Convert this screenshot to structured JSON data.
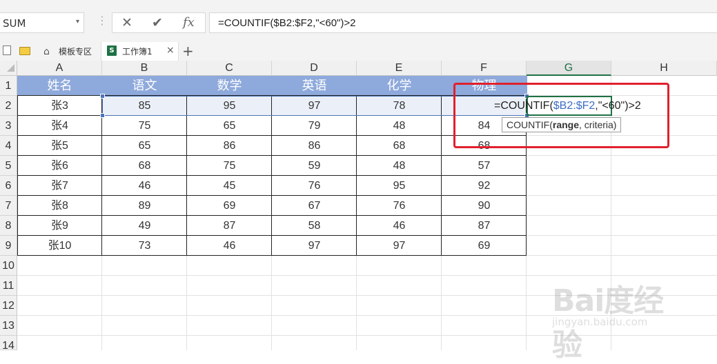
{
  "formula_bar": {
    "name_box": "SUM",
    "name_box_arrow": "▾",
    "cancel_glyph": "✕",
    "enter_glyph": "✔",
    "fx_glyph": "fx",
    "formula": "=COUNTIF($B2:$F2,\"<60\")>2"
  },
  "tabs": {
    "templates_label": "模板专区",
    "workbook_label": "工作簿1",
    "workbook_icon_text": "S",
    "close_glyph": "×",
    "add_glyph": "+"
  },
  "icons": {
    "new_file": "file-icon",
    "open_folder": "folder-icon",
    "home": "home-icon",
    "spreadsheet": "spreadsheet-icon"
  },
  "columns": [
    "A",
    "B",
    "C",
    "D",
    "E",
    "F",
    "G",
    "H"
  ],
  "rows": [
    "1",
    "2",
    "3",
    "4",
    "5",
    "6",
    "7",
    "8",
    "9",
    "10",
    "11",
    "12",
    "13",
    "14"
  ],
  "table": {
    "headers": [
      "姓名",
      "语文",
      "数学",
      "英语",
      "化学",
      "物理"
    ],
    "data": [
      [
        "张3",
        "85",
        "95",
        "97",
        "78",
        ""
      ],
      [
        "张4",
        "75",
        "65",
        "79",
        "48",
        "84"
      ],
      [
        "张5",
        "65",
        "86",
        "86",
        "68",
        "68"
      ],
      [
        "张6",
        "68",
        "75",
        "59",
        "48",
        "57"
      ],
      [
        "张7",
        "46",
        "45",
        "76",
        "95",
        "92"
      ],
      [
        "张8",
        "89",
        "69",
        "67",
        "76",
        "90"
      ],
      [
        "张9",
        "49",
        "87",
        "58",
        "46",
        "87"
      ],
      [
        "张10",
        "73",
        "46",
        "97",
        "97",
        "69"
      ]
    ]
  },
  "editing": {
    "prefix": "=COUNTIF(",
    "ref": "$B2:$F2",
    "suffix": ",\"<60\")>2",
    "tooltip_fn": "COUNTIF(",
    "tooltip_arg1": "range",
    "tooltip_rest": ", criteria)"
  },
  "watermark": {
    "logo": "Bai度经验",
    "url": "jingyan.baidu.com"
  },
  "colors": {
    "header_fill": "#8ea9db",
    "selection": "#4a74b9",
    "active_cell": "#1e7145",
    "annotation": "#e0202c"
  }
}
